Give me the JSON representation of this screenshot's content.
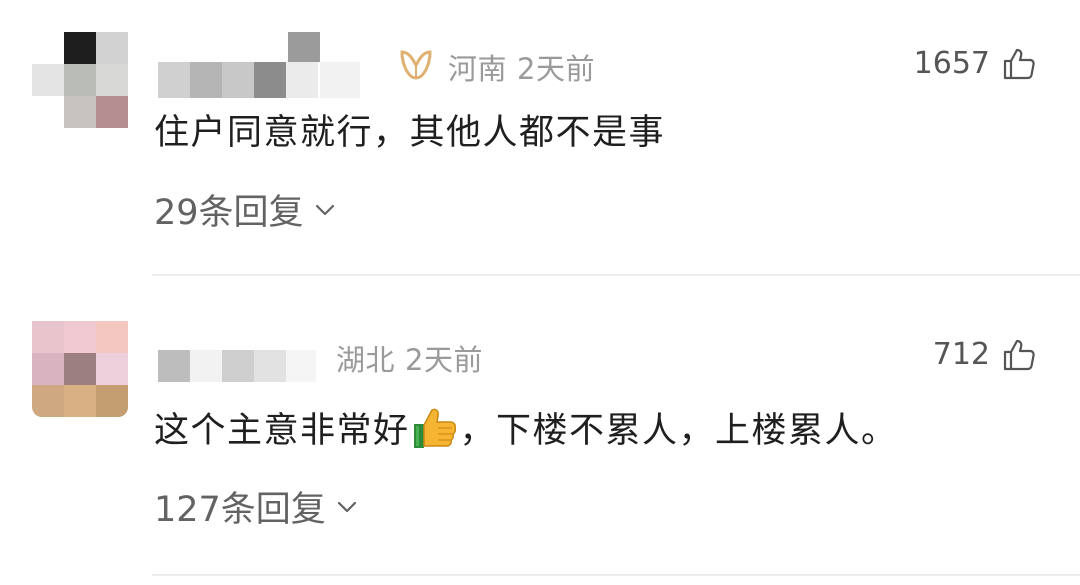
{
  "comments": [
    {
      "region": "河南",
      "time": "2天前",
      "likes": "1657",
      "content_before_emoji": "住户同意就行，其他人都不是事",
      "content_after_emoji": "",
      "replies_label": "29条回复",
      "has_badge": true,
      "badge_color": "#e0b070"
    },
    {
      "region": "湖北",
      "time": "2天前",
      "likes": "712",
      "content_before_emoji": "这个主意非常好",
      "content_after_emoji": "，下楼不累人，上楼累人。",
      "replies_label": "127条回复",
      "has_badge": false
    }
  ],
  "icons": {
    "like": "thumbs-up-outline-icon",
    "expand": "chevron-down-icon",
    "emoji": "thumbs-up-emoji"
  },
  "colors": {
    "meta": "#9a9a9a",
    "text": "#1f1f1f",
    "replies": "#636363",
    "divider": "#ececec"
  }
}
